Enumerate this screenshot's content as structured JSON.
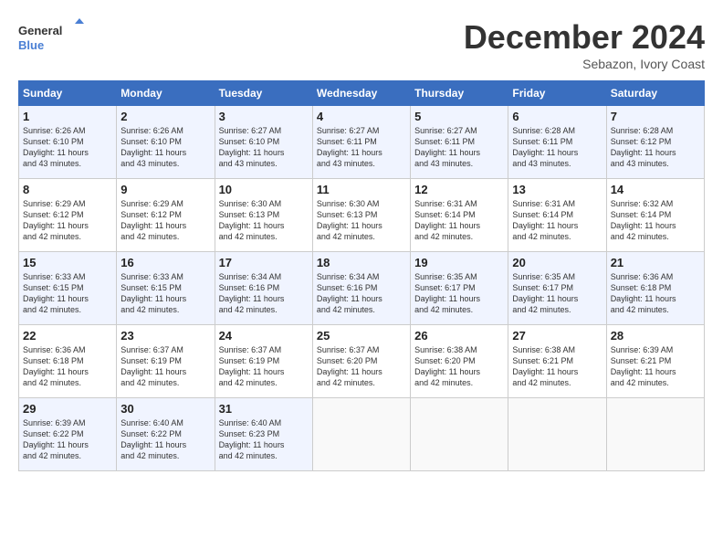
{
  "header": {
    "logo_line1": "General",
    "logo_line2": "Blue",
    "month": "December 2024",
    "location": "Sebazon, Ivory Coast"
  },
  "weekdays": [
    "Sunday",
    "Monday",
    "Tuesday",
    "Wednesday",
    "Thursday",
    "Friday",
    "Saturday"
  ],
  "weeks": [
    [
      {
        "day": "1",
        "sunrise": "6:26 AM",
        "sunset": "6:10 PM",
        "daylight": "11 hours and 43 minutes."
      },
      {
        "day": "2",
        "sunrise": "6:26 AM",
        "sunset": "6:10 PM",
        "daylight": "11 hours and 43 minutes."
      },
      {
        "day": "3",
        "sunrise": "6:27 AM",
        "sunset": "6:10 PM",
        "daylight": "11 hours and 43 minutes."
      },
      {
        "day": "4",
        "sunrise": "6:27 AM",
        "sunset": "6:11 PM",
        "daylight": "11 hours and 43 minutes."
      },
      {
        "day": "5",
        "sunrise": "6:27 AM",
        "sunset": "6:11 PM",
        "daylight": "11 hours and 43 minutes."
      },
      {
        "day": "6",
        "sunrise": "6:28 AM",
        "sunset": "6:11 PM",
        "daylight": "11 hours and 43 minutes."
      },
      {
        "day": "7",
        "sunrise": "6:28 AM",
        "sunset": "6:12 PM",
        "daylight": "11 hours and 43 minutes."
      }
    ],
    [
      {
        "day": "8",
        "sunrise": "6:29 AM",
        "sunset": "6:12 PM",
        "daylight": "11 hours and 42 minutes."
      },
      {
        "day": "9",
        "sunrise": "6:29 AM",
        "sunset": "6:12 PM",
        "daylight": "11 hours and 42 minutes."
      },
      {
        "day": "10",
        "sunrise": "6:30 AM",
        "sunset": "6:13 PM",
        "daylight": "11 hours and 42 minutes."
      },
      {
        "day": "11",
        "sunrise": "6:30 AM",
        "sunset": "6:13 PM",
        "daylight": "11 hours and 42 minutes."
      },
      {
        "day": "12",
        "sunrise": "6:31 AM",
        "sunset": "6:14 PM",
        "daylight": "11 hours and 42 minutes."
      },
      {
        "day": "13",
        "sunrise": "6:31 AM",
        "sunset": "6:14 PM",
        "daylight": "11 hours and 42 minutes."
      },
      {
        "day": "14",
        "sunrise": "6:32 AM",
        "sunset": "6:14 PM",
        "daylight": "11 hours and 42 minutes."
      }
    ],
    [
      {
        "day": "15",
        "sunrise": "6:33 AM",
        "sunset": "6:15 PM",
        "daylight": "11 hours and 42 minutes."
      },
      {
        "day": "16",
        "sunrise": "6:33 AM",
        "sunset": "6:15 PM",
        "daylight": "11 hours and 42 minutes."
      },
      {
        "day": "17",
        "sunrise": "6:34 AM",
        "sunset": "6:16 PM",
        "daylight": "11 hours and 42 minutes."
      },
      {
        "day": "18",
        "sunrise": "6:34 AM",
        "sunset": "6:16 PM",
        "daylight": "11 hours and 42 minutes."
      },
      {
        "day": "19",
        "sunrise": "6:35 AM",
        "sunset": "6:17 PM",
        "daylight": "11 hours and 42 minutes."
      },
      {
        "day": "20",
        "sunrise": "6:35 AM",
        "sunset": "6:17 PM",
        "daylight": "11 hours and 42 minutes."
      },
      {
        "day": "21",
        "sunrise": "6:36 AM",
        "sunset": "6:18 PM",
        "daylight": "11 hours and 42 minutes."
      }
    ],
    [
      {
        "day": "22",
        "sunrise": "6:36 AM",
        "sunset": "6:18 PM",
        "daylight": "11 hours and 42 minutes."
      },
      {
        "day": "23",
        "sunrise": "6:37 AM",
        "sunset": "6:19 PM",
        "daylight": "11 hours and 42 minutes."
      },
      {
        "day": "24",
        "sunrise": "6:37 AM",
        "sunset": "6:19 PM",
        "daylight": "11 hours and 42 minutes."
      },
      {
        "day": "25",
        "sunrise": "6:37 AM",
        "sunset": "6:20 PM",
        "daylight": "11 hours and 42 minutes."
      },
      {
        "day": "26",
        "sunrise": "6:38 AM",
        "sunset": "6:20 PM",
        "daylight": "11 hours and 42 minutes."
      },
      {
        "day": "27",
        "sunrise": "6:38 AM",
        "sunset": "6:21 PM",
        "daylight": "11 hours and 42 minutes."
      },
      {
        "day": "28",
        "sunrise": "6:39 AM",
        "sunset": "6:21 PM",
        "daylight": "11 hours and 42 minutes."
      }
    ],
    [
      {
        "day": "29",
        "sunrise": "6:39 AM",
        "sunset": "6:22 PM",
        "daylight": "11 hours and 42 minutes."
      },
      {
        "day": "30",
        "sunrise": "6:40 AM",
        "sunset": "6:22 PM",
        "daylight": "11 hours and 42 minutes."
      },
      {
        "day": "31",
        "sunrise": "6:40 AM",
        "sunset": "6:23 PM",
        "daylight": "11 hours and 42 minutes."
      },
      null,
      null,
      null,
      null
    ]
  ]
}
